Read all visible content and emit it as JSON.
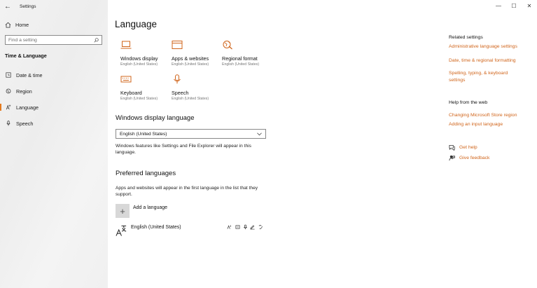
{
  "window": {
    "title": "Settings",
    "back_glyph": "←",
    "minimize": "—",
    "maximize": "☐",
    "close": "✕"
  },
  "nav": {
    "home": "Home",
    "search_placeholder": "Find a setting",
    "section": "Time & Language",
    "items": [
      {
        "label": "Date & time",
        "icon": "clock-icon"
      },
      {
        "label": "Region",
        "icon": "globe-icon"
      },
      {
        "label": "Language",
        "icon": "language-icon",
        "selected": true
      },
      {
        "label": "Speech",
        "icon": "microphone-icon"
      }
    ]
  },
  "page": {
    "title": "Language",
    "tiles": [
      {
        "name": "Windows display",
        "sub": "English (United States)",
        "icon": "laptop-icon"
      },
      {
        "name": "Apps & websites",
        "sub": "English (United States)",
        "icon": "window-icon"
      },
      {
        "name": "Regional format",
        "sub": "English (United States)",
        "icon": "regional-format-icon"
      },
      {
        "name": "Keyboard",
        "sub": "English (United States)",
        "icon": "keyboard-icon"
      },
      {
        "name": "Speech",
        "sub": "English (United States)",
        "icon": "microphone-icon"
      }
    ],
    "display_language": {
      "heading": "Windows display language",
      "selected": "English (United States)",
      "description": "Windows features like Settings and File Explorer will appear in this language."
    },
    "preferred": {
      "heading": "Preferred languages",
      "description": "Apps and websites will appear in the first language in the list that they support.",
      "add_plus": "+",
      "add_label": "Add a language",
      "languages": [
        {
          "name": "English (United States)"
        }
      ]
    }
  },
  "related": {
    "heading": "Related settings",
    "links": [
      "Administrative language settings",
      "Date, time & regional formatting",
      "Spelling, typing, & keyboard settings"
    ]
  },
  "help": {
    "heading": "Help from the web",
    "links": [
      "Changing Microsoft Store region",
      "Adding an input language"
    ],
    "get_help": "Get help",
    "feedback": "Give feedback"
  },
  "colors": {
    "accent": "#d0641a",
    "sidebar": "#f0f0f0"
  }
}
